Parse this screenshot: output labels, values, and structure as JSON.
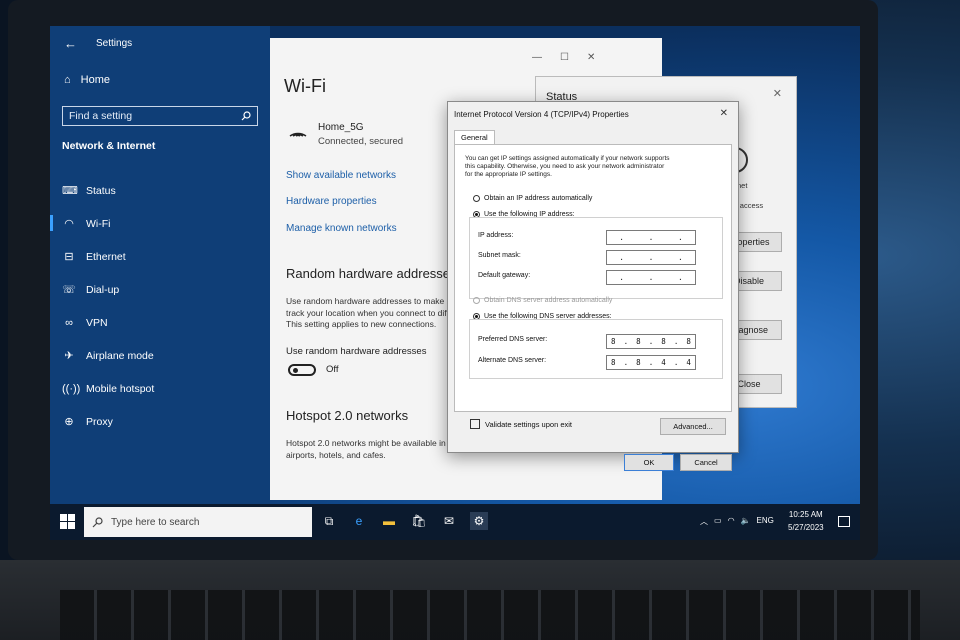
{
  "settings": {
    "window_title": "Settings",
    "home_label": "Home",
    "search_placeholder": "Find a setting",
    "section_title": "Network & Internet",
    "nav_items": [
      {
        "label": "Status",
        "icon": "status-icon"
      },
      {
        "label": "Wi-Fi",
        "icon": "wifi-icon",
        "active": true
      },
      {
        "label": "Ethernet",
        "icon": "ethernet-icon"
      },
      {
        "label": "Dial-up",
        "icon": "dialup-icon"
      },
      {
        "label": "VPN",
        "icon": "vpn-icon"
      },
      {
        "label": "Airplane mode",
        "icon": "airplane-icon"
      },
      {
        "label": "Mobile hotspot",
        "icon": "hotspot-icon"
      },
      {
        "label": "Proxy",
        "icon": "proxy-icon"
      }
    ]
  },
  "wifi_page": {
    "title": "Wi-Fi",
    "network_name": "Home_5G",
    "network_status": "Connected, secured",
    "link_show_networks": "Show available networks",
    "link_hardware": "Hardware properties",
    "link_manage": "Manage known networks",
    "random_hw_heading": "Random hardware addresses",
    "random_hw_desc_1": "Use random hardware addresses to make it h",
    "random_hw_desc_2": "track your location when you connect to differ",
    "random_hw_desc_3": "This setting applies to new connections.",
    "toggle_label": "Use random hardware addresses",
    "toggle_state": "Off",
    "hotspot_heading": "Hotspot 2.0 networks",
    "hotspot_desc_1": "Hotspot 2.0 networks might be available in c",
    "hotspot_desc_2": "airports, hotels, and cafes."
  },
  "status_window": {
    "title": "Status",
    "internet_label": "Internet",
    "access_label": "o Internet access",
    "properties_button": "Properties",
    "disable_button": "Disable",
    "diagnose_button": "Diagnose",
    "close_button": "Close"
  },
  "ipv4_dialog": {
    "title": "Internet Protocol Version 4 (TCP/IPv4) Properties",
    "tab": "General",
    "intro_1": "You can get IP settings assigned automatically if your network supports",
    "intro_2": "this capability. Otherwise, you need to ask your network administrator",
    "intro_3": "for the appropriate IP settings.",
    "radio_auto_ip": "Obtain an IP address automatically",
    "radio_manual_ip": "Use the following IP address:",
    "ip_address_label": "IP address:",
    "subnet_label": "Subnet mask:",
    "gateway_label": "Default gateway:",
    "radio_auto_dns": "Obtain DNS server address automatically",
    "radio_manual_dns": "Use the following DNS server addresses:",
    "preferred_dns_label": "Preferred DNS server:",
    "preferred_dns": [
      "8",
      "8",
      "8",
      "8"
    ],
    "alternate_dns_label": "Alternate DNS server:",
    "alternate_dns": [
      "8",
      "8",
      "4",
      "4"
    ],
    "validate_label": "Validate settings upon exit",
    "advanced_button": "Advanced...",
    "ok_button": "OK",
    "cancel_button": "Cancel"
  },
  "taskbar": {
    "search_placeholder": "Type here to search",
    "language": "ENG",
    "time": "10:25 AM",
    "date": "5/27/2023"
  },
  "colors": {
    "sidebar": "#0f3e77",
    "link": "#1d5fa8",
    "taskbar": "#0b1a2e"
  }
}
